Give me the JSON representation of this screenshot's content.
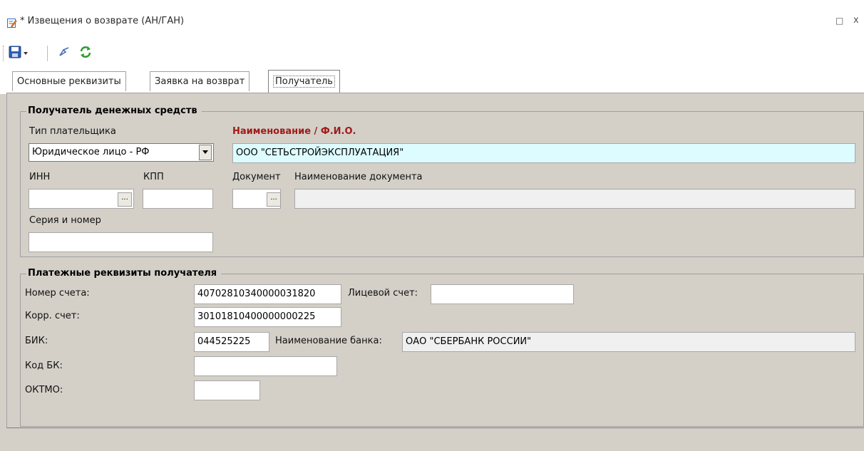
{
  "window": {
    "title": "* Извещения о возврате (АН/ГАН)",
    "restore_icon": "□",
    "close_icon": "x"
  },
  "tabs": [
    {
      "label": "Основные реквизиты"
    },
    {
      "label": "Заявка на возврат"
    },
    {
      "label": "Получатель"
    }
  ],
  "recipient": {
    "group_title": "Получатель денежных средств",
    "payer_type_label": "Тип плательщика",
    "payer_type_value": "Юридическое лицо - РФ",
    "name_label": "Наименование / Ф.И.О.",
    "name_value": "ООО \"СЕТЬСТРОЙЭКСПЛУАТАЦИЯ\"",
    "inn_label": "ИНН",
    "inn_value": "",
    "kpp_label": "КПП",
    "kpp_value": "",
    "document_label": "Документ",
    "document_value": "",
    "document_name_label": "Наименование документа",
    "document_name_value": "",
    "series_label": "Серия и номер",
    "series_value": ""
  },
  "payment": {
    "group_title": "Платежные реквизиты получателя",
    "account_label": "Номер счета:",
    "account_value": "40702810340000031820",
    "personal_account_label": "Лицевой счет:",
    "personal_account_value": "",
    "corr_label": "Корр. счет:",
    "corr_value": "30101810400000000225",
    "bik_label": "БИК:",
    "bik_value": "044525225",
    "bank_name_label": "Наименование банка:",
    "bank_name_value": "ОАО \"СБЕРБАНК РОССИИ\"",
    "kbk_label": "Код БК:",
    "kbk_value": "",
    "oktmo_label": "ОКТМО:",
    "oktmo_value": ""
  },
  "ellipsis": "...",
  "colors": {
    "form_bg": "#d4d0c8",
    "required_label": "#a01a1a",
    "highlight_field": "#ddfcff"
  }
}
